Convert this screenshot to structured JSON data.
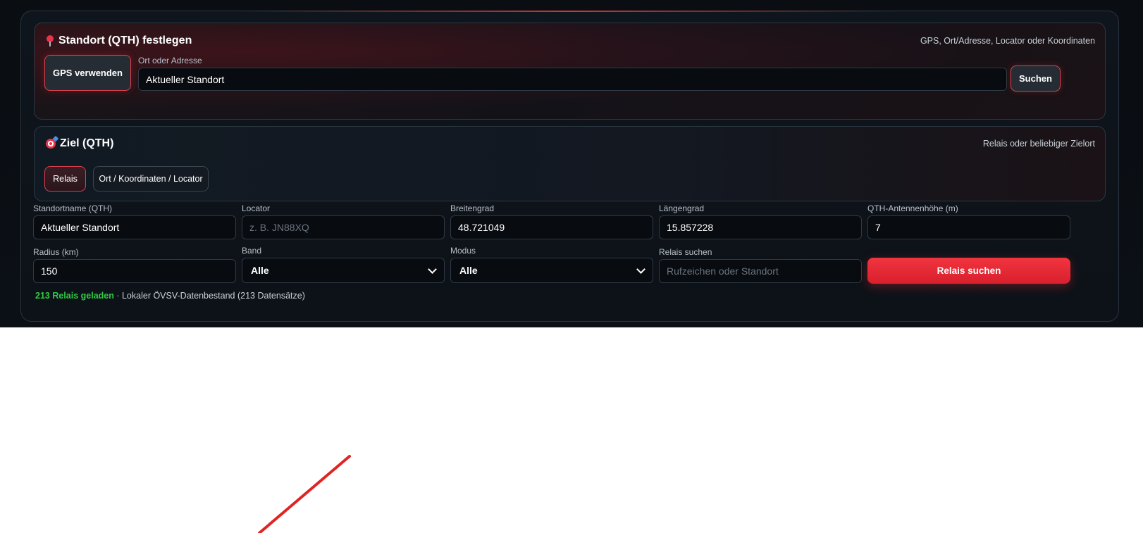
{
  "qth_panel": {
    "title": "Standort (QTH) festlegen",
    "hint": "GPS, Ort/Adresse, Locator oder Koordinaten",
    "gps_button": "GPS verwenden",
    "address_label": "Ort oder Adresse",
    "address_value": "Aktueller Standort",
    "search_button": "Suchen"
  },
  "ziel_panel": {
    "title": "Ziel (QTH)",
    "hint": "Relais oder beliebiger Zielort",
    "tabs": [
      {
        "label": "Relais",
        "active": true
      },
      {
        "label": "Ort / Koordinaten / Locator",
        "active": false
      }
    ]
  },
  "fields": {
    "standortname": {
      "label": "Standortname (QTH)",
      "value": "Aktueller Standort"
    },
    "locator": {
      "label": "Locator",
      "value": "",
      "placeholder": "z. B. JN88XQ"
    },
    "breitengrad": {
      "label": "Breitengrad",
      "value": "48.721049"
    },
    "laengengrad": {
      "label": "Längengrad",
      "value": "15.857228"
    },
    "antennenhoehe": {
      "label": "QTH-Antennenhöhe (m)",
      "value": "7"
    },
    "radius": {
      "label": "Radius (km)",
      "value": "150"
    },
    "band": {
      "label": "Band",
      "selected": "Alle"
    },
    "modus": {
      "label": "Modus",
      "selected": "Alle"
    },
    "relais_suchen": {
      "label": "Relais suchen",
      "value": "",
      "placeholder": "Rufzeichen oder Standort"
    }
  },
  "actions": {
    "relais_search_button": "Relais suchen"
  },
  "status": {
    "count_text": "213 Relais geladen",
    "separator": " · ",
    "source_text": "Lokaler ÖVSV-Datenbestand (213 Datensätze)"
  },
  "colors": {
    "accent_red": "#e53935",
    "status_green": "#2ecc40",
    "background": "#0a0d12"
  },
  "icons": {
    "qth_title_icon": "map-pin-icon",
    "ziel_title_icon": "target-icon",
    "select_chevron": "chevron-down-icon"
  }
}
